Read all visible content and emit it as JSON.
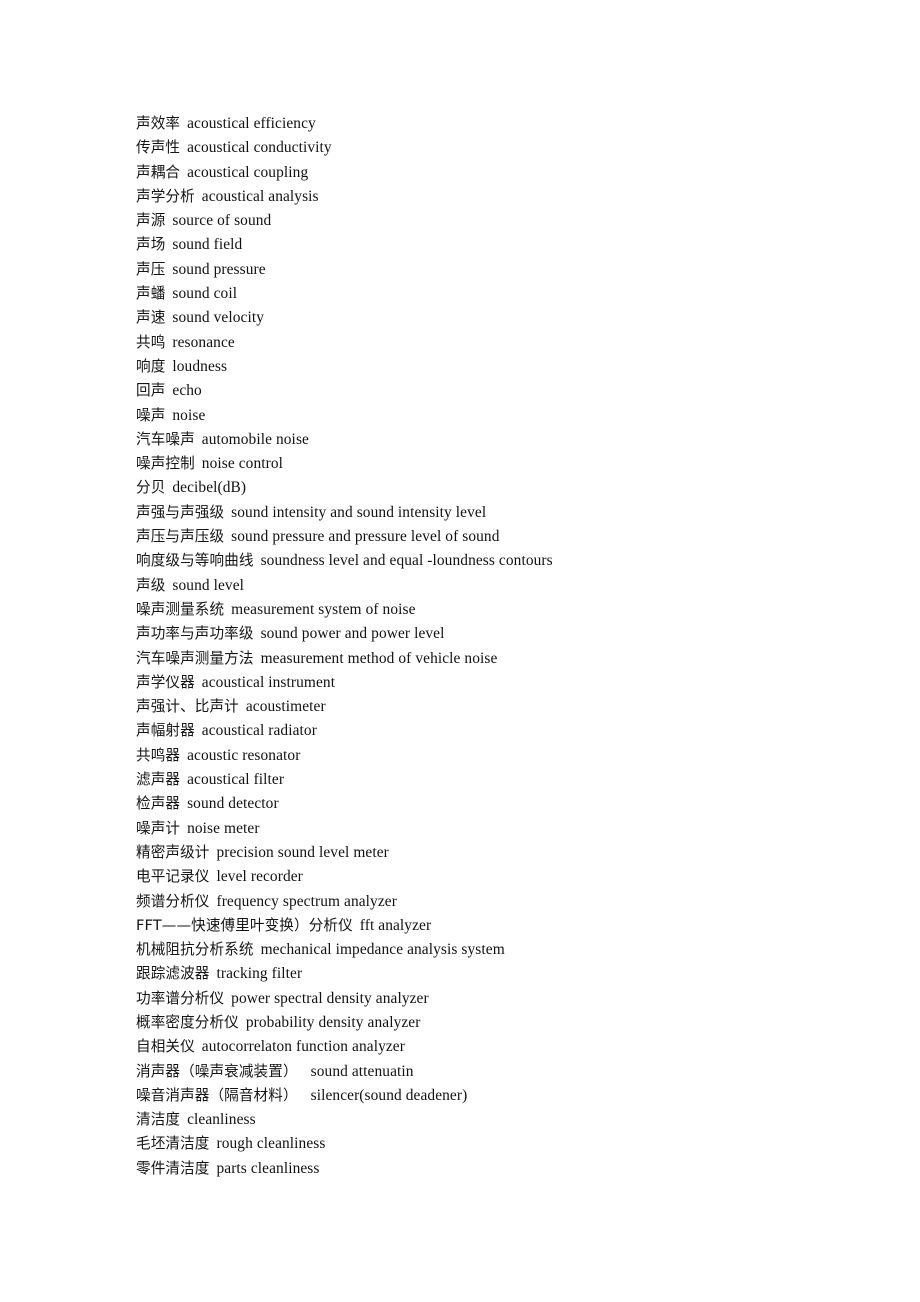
{
  "document": {
    "page_background": "#ffffff",
    "text_color": "#111111",
    "entries": [
      {
        "term": "声效率",
        "gloss": "acoustical efficiency",
        "wide_gap": false
      },
      {
        "term": "传声性",
        "gloss": "acoustical conductivity",
        "wide_gap": false
      },
      {
        "term": "声耦合",
        "gloss": "acoustical coupling",
        "wide_gap": false
      },
      {
        "term": "声学分析",
        "gloss": "acoustical analysis",
        "wide_gap": false
      },
      {
        "term": "声源",
        "gloss": "source of sound",
        "wide_gap": false
      },
      {
        "term": "声场",
        "gloss": "sound field",
        "wide_gap": false
      },
      {
        "term": "声压",
        "gloss": "sound pressure",
        "wide_gap": false
      },
      {
        "term": "声蟠",
        "gloss": "sound coil",
        "wide_gap": false
      },
      {
        "term": "声速",
        "gloss": "sound velocity",
        "wide_gap": false
      },
      {
        "term": "共鸣",
        "gloss": "resonance",
        "wide_gap": false
      },
      {
        "term": "响度",
        "gloss": "loudness",
        "wide_gap": false
      },
      {
        "term": "回声",
        "gloss": "echo",
        "wide_gap": false
      },
      {
        "term": "噪声",
        "gloss": "noise",
        "wide_gap": false
      },
      {
        "term": "汽车噪声",
        "gloss": "automobile noise",
        "wide_gap": false
      },
      {
        "term": "噪声控制",
        "gloss": "noise control",
        "wide_gap": false
      },
      {
        "term": "分贝",
        "gloss": "decibel(dB)",
        "wide_gap": false
      },
      {
        "term": "声强与声强级",
        "gloss": "sound intensity and sound intensity level",
        "wide_gap": false
      },
      {
        "term": "声压与声压级",
        "gloss": "sound pressure and pressure level of sound",
        "wide_gap": false
      },
      {
        "term": "响度级与等响曲线",
        "gloss": "soundness level and equal -loundness contours",
        "wide_gap": false
      },
      {
        "term": "声级",
        "gloss": "sound level",
        "wide_gap": false
      },
      {
        "term": "噪声测量系统",
        "gloss": "measurement system of noise",
        "wide_gap": false
      },
      {
        "term": "声功率与声功率级",
        "gloss": "sound power and power level",
        "wide_gap": false
      },
      {
        "term": "汽车噪声测量方法",
        "gloss": "measurement method of vehicle noise",
        "wide_gap": false
      },
      {
        "term": "声学仪器",
        "gloss": "acoustical instrument",
        "wide_gap": false
      },
      {
        "term": "声强计、比声计",
        "gloss": "acoustimeter",
        "wide_gap": false
      },
      {
        "term": "声幅射器",
        "gloss": "acoustical radiator",
        "wide_gap": false
      },
      {
        "term": "共鸣器",
        "gloss": "acoustic resonator",
        "wide_gap": false
      },
      {
        "term": "滤声器",
        "gloss": "acoustical filter",
        "wide_gap": false
      },
      {
        "term": "检声器",
        "gloss": "sound detector",
        "wide_gap": false
      },
      {
        "term": "噪声计",
        "gloss": "noise meter",
        "wide_gap": false
      },
      {
        "term": "精密声级计",
        "gloss": "precision sound level meter",
        "wide_gap": false
      },
      {
        "term": "电平记录仪",
        "gloss": "level recorder",
        "wide_gap": false
      },
      {
        "term": "频谱分析仪",
        "gloss": "frequency spectrum analyzer",
        "wide_gap": false
      },
      {
        "term": "FFT——快速傅里叶变换）分析仪",
        "gloss": "fft analyzer",
        "wide_gap": false
      },
      {
        "term": "机械阻抗分析系统",
        "gloss": "mechanical impedance analysis system",
        "wide_gap": false
      },
      {
        "term": "跟踪滤波器",
        "gloss": "tracking filter",
        "wide_gap": false
      },
      {
        "term": "功率谱分析仪",
        "gloss": "power spectral density analyzer",
        "wide_gap": false
      },
      {
        "term": "概率密度分析仪",
        "gloss": "probability density analyzer",
        "wide_gap": false
      },
      {
        "term": "自相关仪",
        "gloss": "autocorrelaton function analyzer",
        "wide_gap": false
      },
      {
        "term": "消声器（噪声衰减装置）",
        "gloss": "sound attenuatin",
        "wide_gap": true
      },
      {
        "term": "噪音消声器（隔音材料）",
        "gloss": "silencer(sound deadener)",
        "wide_gap": true
      },
      {
        "term": "清洁度",
        "gloss": "cleanliness",
        "wide_gap": false
      },
      {
        "term": "毛坯清洁度",
        "gloss": "rough cleanliness",
        "wide_gap": false
      },
      {
        "term": "零件清洁度",
        "gloss": "parts cleanliness",
        "wide_gap": false
      }
    ]
  }
}
